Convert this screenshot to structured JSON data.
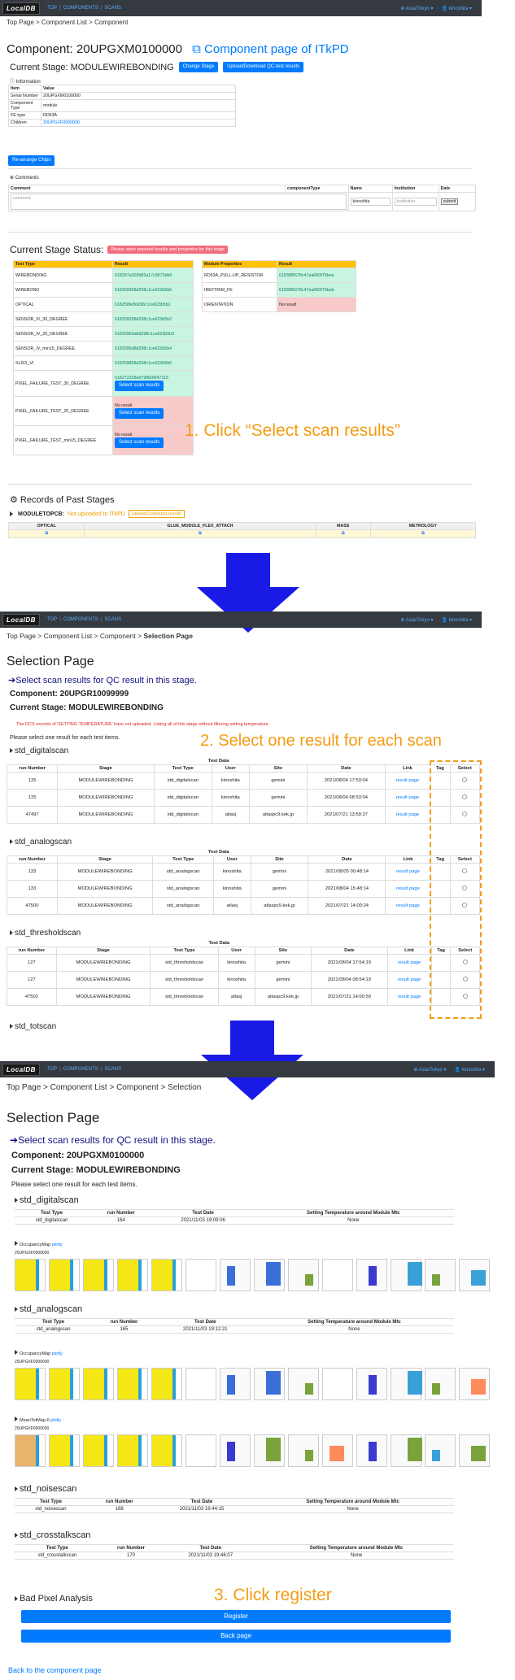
{
  "s1": {
    "nav": {
      "logo": "LocalDB",
      "top": "TOP",
      "components": "COMPONENTS",
      "scans": "SCANS",
      "tz": "Asia/Tokyo",
      "user": "kinoshita"
    },
    "breadcrumb": "Top Page > Component List > Component",
    "component_title": "Component: 20UPGXM0100000",
    "itkpd_link": "Component page of ITkPD",
    "current_stage": "Current Stage: MODULEWIREBONDING",
    "change_stage": "Change Stage",
    "upload_qc": "Upload/Download QC-test results",
    "info_label": "Information",
    "info_head": [
      "Item",
      "Value"
    ],
    "info_rows": [
      [
        "Serial Number",
        "20UPGXM0100000"
      ],
      [
        "Component Type",
        "module"
      ],
      [
        "FE type",
        "RD53A"
      ],
      [
        "Children",
        "20UPGXF0000000"
      ]
    ],
    "rearrange": "Re-arrange Chips",
    "comments_label": "Comments",
    "comment_head": [
      "Comment",
      "componentType",
      "Name",
      "Institution",
      "Date"
    ],
    "comment_placeholder": "comment",
    "name_value": "kinoshita",
    "institution_placeholder": "institution",
    "submit": "submit",
    "stage_status": "Current Stage Status:",
    "stage_badge": "Please store required results and properties for this stage",
    "test_head": [
      "Test Type",
      "Result"
    ],
    "tests": [
      {
        "name": "WIREBONDING",
        "result": "618297a303b82a17c9673db0"
      },
      {
        "name": "WIREBOND",
        "result": "618259998d298c1ce623b5b6"
      },
      {
        "name": "OPTICAL",
        "result": "618258fe8d298c1ce623b5b1"
      },
      {
        "name": "SENSOR_IV_30_DEGREE",
        "result": "618259298d298c1ce623b5b2"
      },
      {
        "name": "SENSOR_IV_20_DEGREE",
        "result": "618259b3a8d298c1ce623b5b3"
      },
      {
        "name": "SENSOR_IV_min15_DEGREE",
        "result": "6182596d8d298c1ce623b5b4"
      },
      {
        "name": "SLDO_VI",
        "result": "618259858d298c1ce623b5b5"
      },
      {
        "name": "PIXEL_FAILURE_TEST_30_DEGREE",
        "result": "618272328a6798b05f47115"
      },
      {
        "name": "PIXEL_FAILURE_TEST_20_DEGREE",
        "result": "No result"
      },
      {
        "name": "PIXEL_FAILURE_TEST_min15_DEGREE",
        "result": "No result"
      }
    ],
    "select_scan": "Select scan results",
    "prop_head": [
      "Module Properties",
      "Result"
    ],
    "props": [
      {
        "name": "RD53A_PULL-UP_RESISTOR",
        "result": "61838f5678c47ea660f79bea"
      },
      {
        "name": "IREFTRIM_FE",
        "result": "61838f6078c47ea660f79beb"
      },
      {
        "name": "ORIENTATION",
        "result": "No result"
      }
    ],
    "annotation1": "1. Click “Select scan results”",
    "records": "Records of Past Stages",
    "moduletopcb": "MODULETOPCB:",
    "not_uploaded": "Not uploaded to ITkPD",
    "upload_results": "Upload/Download results",
    "past_head": [
      "OPTICAL",
      "GLUE_MODULE_FLEX_ATTACH",
      "MASS",
      "METROLOGY"
    ]
  },
  "s2": {
    "breadcrumb_a": "Top Page > Component List > Component > ",
    "breadcrumb_b": "Selection Page",
    "title": "Selection Page",
    "select_note": "Select scan results for QC result in this stage.",
    "component": "Component: 20UPGR10099999",
    "stage": "Current Stage: MODULEWIREBONDING",
    "warning": "The DCS records of 'SETTING TEMPERATURE' have not uploaded. Listing all of this stage without filtering setting temperature.",
    "please": "Please select one result for each test items.",
    "annotation2": "2. Select one result for each scan",
    "test_data": "Test Data",
    "cols": [
      "run Number",
      "Stage",
      "Test Type",
      "User",
      "Site",
      "Date",
      "Link",
      "Tag",
      "Select"
    ],
    "groups": [
      {
        "name": "std_digitalscan",
        "rows": [
          [
            "125",
            "MODULEWIREBONDING",
            "std_digitalscan",
            "kinoshita",
            "gemini",
            "2021/08/04 17:53:04",
            "result page"
          ],
          [
            "125",
            "MODULEWIREBONDING",
            "std_digitalscan",
            "kinoshita",
            "gemini",
            "2021/08/04 08:53:04",
            "result page"
          ],
          [
            "47497",
            "MODULEWIREBONDING",
            "std_digitalscan",
            "atlasj",
            "atlaspc9.kek.jp",
            "2021/07/21 13:59:37",
            "result page"
          ]
        ]
      },
      {
        "name": "std_analogscan",
        "rows": [
          [
            "133",
            "MODULEWIREBONDING",
            "std_analogscan",
            "kinoshita",
            "gemini",
            "2021/08/05 00:48:14",
            "result page"
          ],
          [
            "133",
            "MODULEWIREBONDING",
            "std_analogscan",
            "kinoshita",
            "gemini",
            "2021/08/04 15:48:14",
            "result page"
          ],
          [
            "47500",
            "MODULEWIREBONDING",
            "std_analogscan",
            "atlasj",
            "atlaspc9.kek.jp",
            "2021/07/21 14:00:24",
            "result page"
          ]
        ]
      },
      {
        "name": "std_thresholdscan",
        "rows": [
          [
            "127",
            "MODULEWIREBONDING",
            "std_thresholdscan",
            "kinoshita",
            "gemini",
            "2021/08/04 17:54:19",
            "result page"
          ],
          [
            "127",
            "MODULEWIREBONDING",
            "std_thresholdscan",
            "kinoshita",
            "gemini",
            "2021/08/04 08:54:19",
            "result page"
          ],
          [
            "47502",
            "MODULEWIREBONDING",
            "std_thresholdscan",
            "atlasj",
            "atlaspc9.kek.jp",
            "2021/07/21 14:00:59",
            "result page"
          ]
        ]
      }
    ],
    "next_group": "std_totscan"
  },
  "s3": {
    "breadcrumb": "Top Page > Component List > Component > Selection",
    "title": "Selection Page",
    "select_note": "Select scan results for QC result in this stage.",
    "component": "Component: 20UPGXM0100000",
    "stage": "Current Stage: MODULEWIREBONDING",
    "please": "Please select one result for each test items.",
    "cols": [
      "Test Type",
      "run Number",
      "Test Date",
      "Setting Temperature around Module Mtc"
    ],
    "scans": [
      {
        "name": "std_digitalscan",
        "row": [
          "std_digitalscan",
          "164",
          "2021/11/03 19:09:06",
          "None"
        ]
      },
      {
        "name": "std_analogscan",
        "row": [
          "std_analogscan",
          "165",
          "2021/11/03 19:12:21",
          "None"
        ]
      },
      {
        "name": "std_noisescan",
        "row": [
          "std_noisescan",
          "168",
          "2021/11/03 19:44:15",
          "None"
        ]
      },
      {
        "name": "std_crosstalkscan",
        "row": [
          "std_crosstalkscan",
          "170",
          "2021/11/03 19:46:07",
          "None"
        ]
      }
    ],
    "occ_label": "OccupancyMap",
    "mean_label": "MeanTotMap-0",
    "plotly": "plotly",
    "chip_id": "20UPGXF0000000",
    "bad_pixel": "Bad Pixel Analysis",
    "annotation3": "3. Click register",
    "register": "Register",
    "back": "Back page",
    "back_component": "Back to the component page"
  },
  "colors": {
    "primary": "#007bff",
    "accent": "#f39c12",
    "arrow": "#1a1ae6",
    "header_yellow": "#ffc107"
  }
}
